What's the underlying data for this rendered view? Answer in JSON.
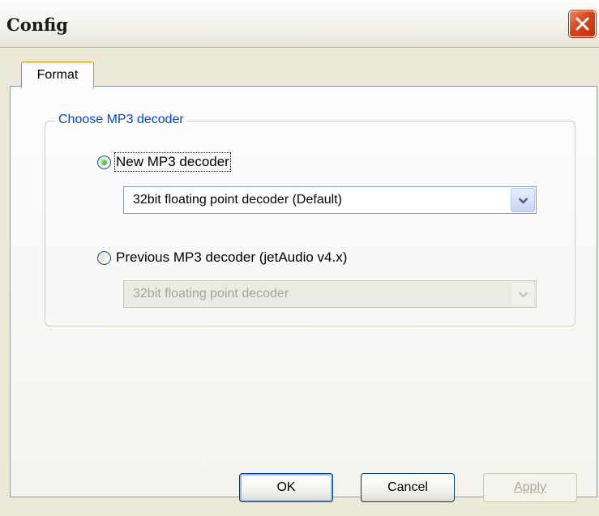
{
  "window": {
    "title": "Config"
  },
  "tabs": [
    {
      "label": "Format"
    }
  ],
  "group": {
    "legend": "Choose MP3 decoder",
    "options": [
      {
        "label": "New MP3 decoder",
        "selected": true,
        "combo_value": "32bit floating point decoder (Default)",
        "combo_enabled": true
      },
      {
        "label": "Previous MP3 decoder (jetAudio v4.x)",
        "selected": false,
        "combo_value": "32bit floating point decoder",
        "combo_enabled": false
      }
    ]
  },
  "buttons": {
    "ok": "OK",
    "cancel": "Cancel",
    "apply": "Apply"
  },
  "icons": {
    "close": "close-icon",
    "dropdown": "chevron-down-icon"
  },
  "colors": {
    "legend": "#0046D5",
    "tab_highlight": "#FFC83C",
    "close_button": "#D8451F"
  }
}
